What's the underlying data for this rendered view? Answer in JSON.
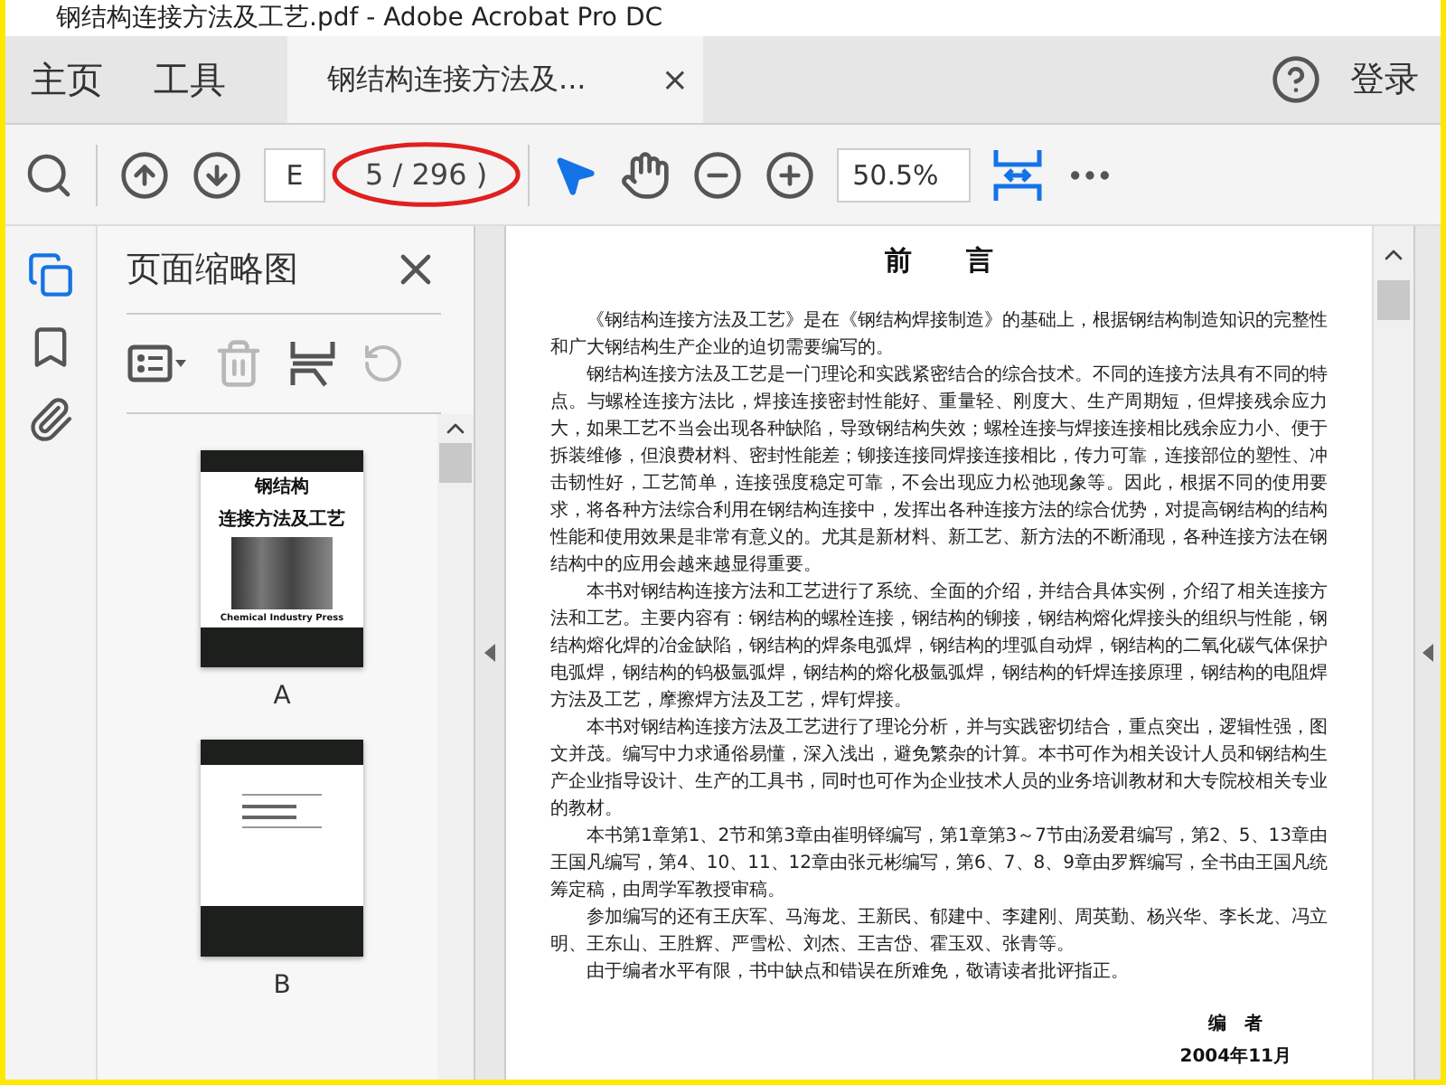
{
  "window": {
    "title": "钢结构连接方法及工艺.pdf - Adobe Acrobat Pro DC"
  },
  "nav_tabs": [
    {
      "label": "主页"
    },
    {
      "label": "工具"
    }
  ],
  "document_tab": {
    "label": "钢结构连接方法及...",
    "close": "×"
  },
  "account": {
    "login": "登录"
  },
  "toolbar": {
    "page_input": "E",
    "page_count": "5 / 296 )",
    "zoom": "50.5%",
    "tools": [
      {
        "kind": "select",
        "selected": true
      },
      {
        "kind": "hand",
        "selected": false
      }
    ]
  },
  "side_tabs": [
    {
      "kind": "pages",
      "selected": true
    },
    {
      "kind": "bookmarks",
      "selected": false
    },
    {
      "kind": "attachments",
      "selected": false
    }
  ],
  "thumbnail_panel": {
    "title": "页面缩略图",
    "actions": [
      {
        "kind": "options",
        "disabled": false
      },
      {
        "kind": "delete",
        "disabled": true
      },
      {
        "kind": "insert",
        "disabled": false
      },
      {
        "kind": "rotate",
        "disabled": true
      }
    ],
    "thumbnails": [
      {
        "kind": "cover",
        "label": "A",
        "title_lines": [
          "钢结构",
          "连接方法及工艺"
        ],
        "publisher": "Chemical Industry Press"
      },
      {
        "kind": "back",
        "label": "B"
      }
    ]
  },
  "page": {
    "heading": "前　　言",
    "paragraphs": [
      "《钢结构连接方法及工艺》是在《钢结构焊接制造》的基础上，根据钢结构制造知识的完整性和广大钢结构生产企业的迫切需要编写的。",
      "钢结构连接方法及工艺是一门理论和实践紧密结合的综合技术。不同的连接方法具有不同的特点。与螺栓连接方法比，焊接连接密封性能好、重量轻、刚度大、生产周期短，但焊接残余应力大，如果工艺不当会出现各种缺陷，导致钢结构失效；螺栓连接与焊接连接相比残余应力小、便于拆装维修，但浪费材料、密封性能差；铆接连接同焊接连接相比，传力可靠，连接部位的塑性、冲击韧性好，工艺简单，连接强度稳定可靠，不会出现应力松弛现象等。因此，根据不同的使用要求，将各种方法综合利用在钢结构连接中，发挥出各种连接方法的综合优势，对提高钢结构的结构性能和使用效果是非常有意义的。尤其是新材料、新工艺、新方法的不断涌现，各种连接方法在钢结构中的应用会越来越显得重要。",
      "本书对钢结构连接方法和工艺进行了系统、全面的介绍，并结合具体实例，介绍了相关连接方法和工艺。主要内容有：钢结构的螺栓连接，钢结构的铆接，钢结构熔化焊接头的组织与性能，钢结构熔化焊的冶金缺陷，钢结构的焊条电弧焊，钢结构的埋弧自动焊，钢结构的二氧化碳气体保护电弧焊，钢结构的钨极氩弧焊，钢结构的熔化极氩弧焊，钢结构的钎焊连接原理，钢结构的电阻焊方法及工艺，摩擦焊方法及工艺，焊钉焊接。",
      "本书对钢结构连接方法及工艺进行了理论分析，并与实践密切结合，重点突出，逻辑性强，图文并茂。编写中力求通俗易懂，深入浅出，避免繁杂的计算。本书可作为相关设计人员和钢结构生产企业指导设计、生产的工具书，同时也可作为企业技术人员的业务培训教材和大专院校相关专业的教材。",
      "本书第1章第1、2节和第3章由崔明铎编写，第1章第3～7节由汤爱君编写，第2、5、13章由王国凡编写，第4、10、11、12章由张元彬编写，第6、7、8、9章由罗辉编写，全书由王国凡统筹定稿，由周学军教授审稿。",
      "参加编写的还有王庆军、马海龙、王新民、郁建中、李建刚、周英勤、杨兴华、李长龙、冯立明、王东山、王胜辉、严雪松、刘杰、王吉岱、霍玉双、张青等。",
      "由于编者水平有限，书中缺点和错误在所难免，敬请读者批评指正。"
    ],
    "signature": "编　者",
    "date": "2004年11月"
  }
}
